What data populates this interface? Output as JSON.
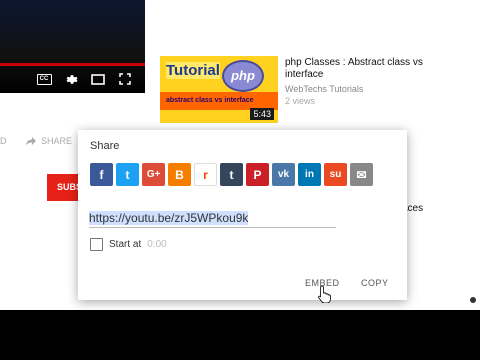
{
  "colors": {
    "facebook": "#3b5998",
    "twitter": "#1da1f2",
    "google_plus": "#dd4b39",
    "blogger": "#f57d00",
    "reddit": "#ff4500",
    "tumblr": "#35465c",
    "pinterest": "#cb2027",
    "vk": "#4a76a8",
    "linkedin": "#0077b5",
    "stumbleupon": "#eb4924",
    "email": "#888888",
    "subscribe": "#e62117"
  },
  "player": {
    "icons": [
      "captions-icon",
      "gear-icon",
      "theater-mode-icon",
      "fullscreen-icon"
    ],
    "captions_text": "CC"
  },
  "suggested": {
    "thumb_word": "Tutorial",
    "thumb_logo": "php",
    "thumb_caption": "abstract class vs interface",
    "duration": "5:43",
    "title": "php Classes : Abstract class vs interface",
    "channel": "WebTechs Tutorials",
    "views": "2 views"
  },
  "background": {
    "d_label": "D",
    "share_label": "SHARE",
    "subscribe_label": "SUBS",
    "aces_text": "aces"
  },
  "share_dialog": {
    "title": "Share",
    "social_buttons": [
      {
        "name": "facebook",
        "glyph": "f"
      },
      {
        "name": "twitter",
        "glyph": "t"
      },
      {
        "name": "google-plus",
        "glyph": "G+"
      },
      {
        "name": "blogger",
        "glyph": "B"
      },
      {
        "name": "reddit",
        "glyph": "r"
      },
      {
        "name": "tumblr",
        "glyph": "t"
      },
      {
        "name": "pinterest",
        "glyph": "P"
      },
      {
        "name": "vk",
        "glyph": "vk"
      },
      {
        "name": "linkedin",
        "glyph": "in"
      },
      {
        "name": "stumbleupon",
        "glyph": "su"
      },
      {
        "name": "email",
        "glyph": "✉"
      }
    ],
    "url": "https://youtu.be/zrJ5WPkou9k",
    "start_at_label": "Start at",
    "start_at_time": "0:00",
    "embed_label": "EMBED",
    "copy_label": "COPY"
  }
}
